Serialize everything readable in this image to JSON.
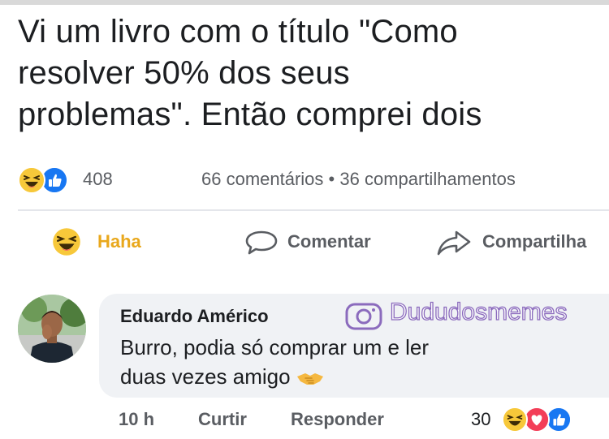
{
  "post": {
    "lines": [
      "Vi um livro com o título \"Como",
      "resolver 50% dos seus",
      "problemas\". Então comprei dois"
    ]
  },
  "stats": {
    "reaction_count": "408",
    "comments": "66 comentários",
    "separator": "•",
    "shares": "36 compartilhamentos"
  },
  "actions": {
    "haha": "Haha",
    "comment": "Comentar",
    "share": "Compartilha"
  },
  "comment": {
    "author": "Eduardo Américo",
    "watermark": "Dududosmemes",
    "text_line1": "Burro, podia só comprar um e ler",
    "text_line2": "duas vezes amigo",
    "age": "10 h",
    "like": "Curtir",
    "reply": "Responder",
    "reaction_count": "30"
  },
  "colors": {
    "haha_accent": "#e9a81c",
    "like_blue": "#1877f2",
    "love_red": "#f33e58",
    "watermark_purple": "#8b6bbd",
    "bubble_bg": "#f0f2f5"
  },
  "icons": [
    "haha-emoji-icon",
    "like-icon",
    "love-icon",
    "comment-icon",
    "share-icon",
    "instagram-icon",
    "handshake-icon"
  ]
}
